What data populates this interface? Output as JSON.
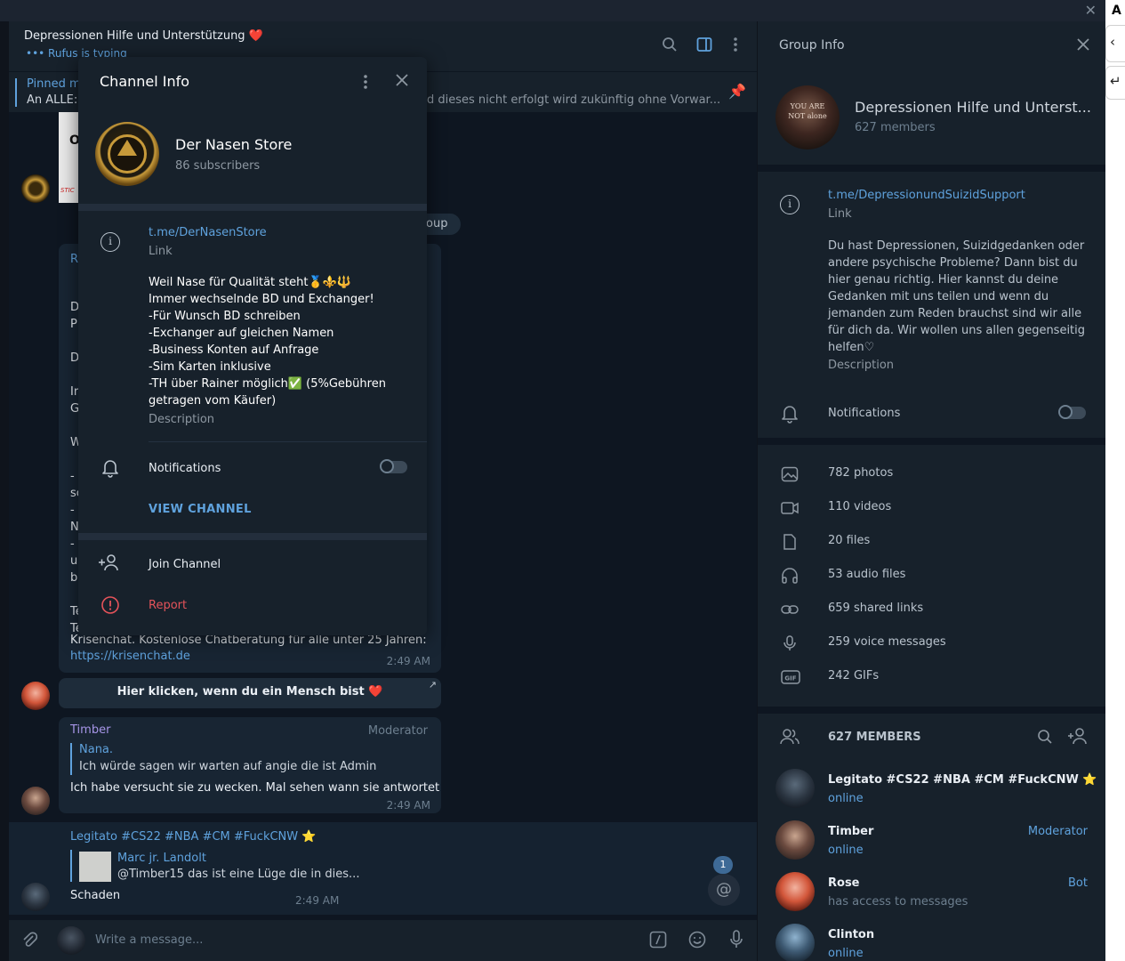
{
  "chat": {
    "title": "Depressionen Hilfe und Unterstützung ❤️",
    "status": "••• Rufus is typing",
    "pinned_title": "Pinned m",
    "pinned_text_left": "An ALLE:",
    "pinned_text_right": "d dieses nicht erfolgt wird zukünftig ohne Vorwar...",
    "service_badge": "roup",
    "msg1_partial_lines": [
      "R",
      "D",
      "P",
      "D",
      "Ir",
      "G",
      "W",
      "-",
      "sc",
      "-",
      "N",
      "-",
      "u",
      "b",
      "Te",
      "Te"
    ],
    "msg1_footer": "Krisenchat. Kostenlose Chatberatung für alle unter 25 Jahren:",
    "msg1_link": "https://krisenchat.de",
    "msg1_time": "2:49 AM",
    "button_text": "Hier klicken, wenn du ein Mensch bist ❤️",
    "msg2_author": "Timber",
    "msg2_role": "Moderator",
    "msg2_reply_author": "Nana.",
    "msg2_reply_text": "Ich würde sagen wir warten auf angie die ist Admin",
    "msg2_text": "Ich habe versucht sie zu wecken. Mal sehen wann sie antwortet",
    "msg2_time": "2:49 AM",
    "msg3_author": "Legitato #CS22 #NBA #CM #FuckCNW ⭐",
    "msg3_reply_author": "Marc jr. Landolt",
    "msg3_reply_text": "@Timber15 das ist eine Lüge die in dies...",
    "msg3_text": "Schaden",
    "msg3_time": "2:49 AM",
    "mentions_count": "1",
    "composer_placeholder": "Write a message..."
  },
  "modal": {
    "title": "Channel Info",
    "channel_name": "Der Nasen Store",
    "subscribers": "86 subscribers",
    "link": "t.me/DerNasenStore",
    "link_label": "Link",
    "description": "Weil Nase für Qualität steht🥇⚜️🔱\nImmer wechselnde BD und Exchanger!\n -Für Wunsch BD schreiben\n-Exchanger auf gleichen Namen\n-Business Konten auf Anfrage\n-Sim Karten inklusive\n-TH über Rainer möglich✅ (5%Gebühren getragen vom Käufer)",
    "description_label": "Description",
    "notifications_label": "Notifications",
    "view_channel": "VIEW CHANNEL",
    "join_channel": "Join Channel",
    "report": "Report"
  },
  "group_info": {
    "title": "Group Info",
    "avatar_text": "YOU ARE NOT alone",
    "name": "Depressionen Hilfe und Unterst...",
    "members": "627 members",
    "link": "t.me/DepressionundSuizidSupport",
    "link_label": "Link",
    "description": "Du hast Depressionen, Suizidgedanken oder andere psychische Probleme? Dann bist du hier genau richtig. Hier kannst du deine Gedanken mit uns teilen und wenn du jemanden zum Reden brauchst sind wir alle für dich da. Wir wollen uns allen gegenseitig helfen♡",
    "description_label": "Description",
    "notifications_label": "Notifications",
    "media": [
      {
        "icon": "photo-icon",
        "label": "782 photos"
      },
      {
        "icon": "video-icon",
        "label": "110 videos"
      },
      {
        "icon": "file-icon",
        "label": "20 files"
      },
      {
        "icon": "headphones-icon",
        "label": "53 audio files"
      },
      {
        "icon": "link-icon",
        "label": "659 shared links"
      },
      {
        "icon": "microphone-icon",
        "label": "259 voice messages"
      },
      {
        "icon": "gif-icon",
        "label": "242 GIFs"
      }
    ],
    "members_header": "627 MEMBERS",
    "member_list": [
      {
        "name": "Legitato #CS22 #NBA #CM #FuckCNW ⭐",
        "status": "online",
        "role": ""
      },
      {
        "name": "Timber",
        "status": "online",
        "role": "Moderator"
      },
      {
        "name": "Rose",
        "status": "has access to messages",
        "role": "Bot"
      },
      {
        "name": "Clinton",
        "status": "online",
        "role": ""
      }
    ]
  },
  "edge": {
    "letter": "A"
  },
  "colors": {
    "accent": "#5fa2dd",
    "danger": "#e5535a",
    "panel": "#17212b",
    "background": "#0e1621"
  }
}
